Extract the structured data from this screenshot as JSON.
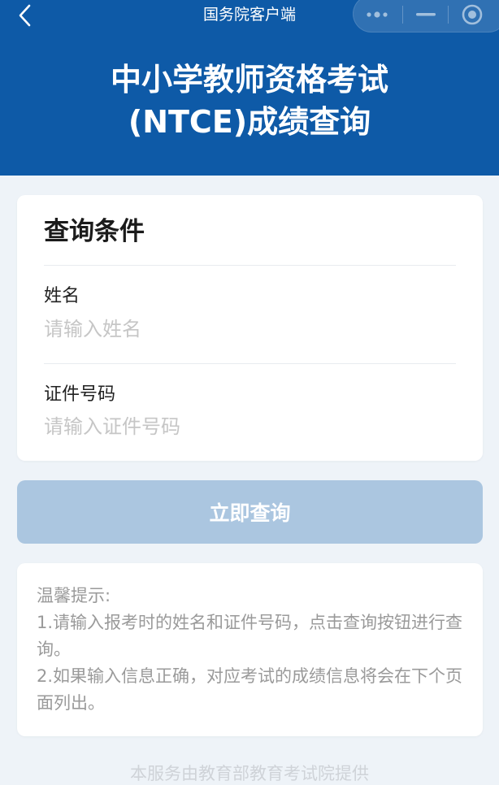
{
  "nav": {
    "title": "国务院客户端",
    "back_icon": "chevron-left-icon",
    "capsule": {
      "more_icon": "more-dots-icon",
      "minimize_icon": "minimize-icon",
      "close_icon": "target-close-icon"
    }
  },
  "header": {
    "title": "中小学教师资格考试\n(NTCE)成绩查询",
    "background_color": "#0e5aa7"
  },
  "form": {
    "section_title": "查询条件",
    "name_label": "姓名",
    "name_placeholder": "请输入姓名",
    "name_value": "",
    "id_label": "证件号码",
    "id_placeholder": "请输入证件号码",
    "id_value": ""
  },
  "query_button": {
    "label": "立即查询",
    "color": "#abc6e0"
  },
  "tips": {
    "title": "温馨提示:",
    "line1": "1.请输入报考时的姓名和证件号码，点击查询按钮进行查询。",
    "line2": "2.如果输入信息正确，对应考试的成绩信息将会在下个页面列出。"
  },
  "footer": {
    "text": "本服务由教育部教育考试院提供"
  }
}
